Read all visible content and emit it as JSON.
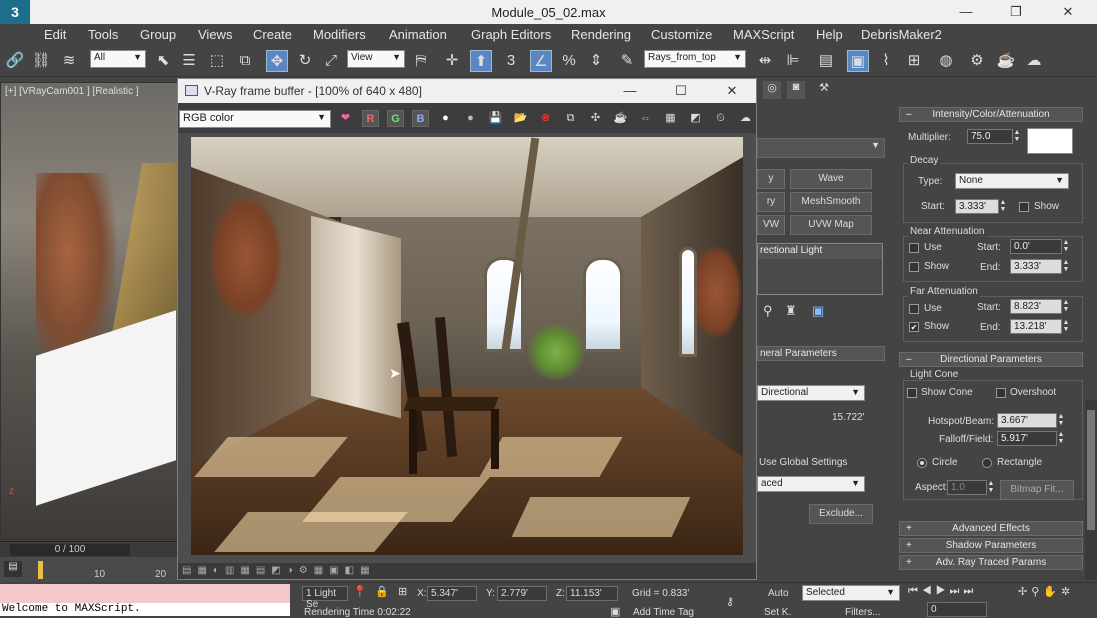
{
  "window": {
    "title": "Module_05_02.max",
    "logo": "3",
    "minimize": "—",
    "restore": "❐",
    "close": "✕"
  },
  "menu": [
    "Edit",
    "Tools",
    "Group",
    "Views",
    "Create",
    "Modifiers",
    "Animation",
    "Graph Editors",
    "Rendering",
    "Customize",
    "MAXScript",
    "Help",
    "DebrisMaker2"
  ],
  "toolbar": {
    "selection_filter": "All",
    "ref_coord": "View",
    "named_selection": "Rays_from_top",
    "snap_3": "3",
    "snap_percent": "%",
    "snap_n": "n"
  },
  "viewport": {
    "label": "[+] [VRayCam001 ] [Realistic ]",
    "axis": "z"
  },
  "timeline": {
    "position": "0 / 100",
    "ticks": [
      "10",
      "20"
    ]
  },
  "listener": {
    "text": "Welcome to MAXScript."
  },
  "vfb": {
    "title": "V-Ray frame buffer - [100% of 640 x 480]",
    "channel": "RGB color",
    "btn_r": "R",
    "btn_g": "G",
    "btn_b": "B",
    "minimize": "—",
    "maximize": "☐",
    "close": "✕"
  },
  "command_panel": {
    "modifier_buttons": {
      "wave": "Wave",
      "meshsmooth": "MeshSmooth",
      "uvwmap": "UVW Map",
      "left_partial_1": "y",
      "left_partial_2": "ry",
      "left_partial_3": "VW"
    },
    "modifier_stack_item": "rectional Light",
    "general_parameters_header": "neral Parameters",
    "light_type": "Directional",
    "targ_dist": "15.722'",
    "use_global_settings": "Use Global Settings",
    "shadow_type": "aced",
    "exclude_btn": "Exclude...",
    "intensity_header": "Intensity/Color/Attenuation",
    "multiplier_label": "Multiplier:",
    "multiplier_value": "75.0",
    "decay": {
      "title": "Decay",
      "type_label": "Type:",
      "type_value": "None",
      "start_label": "Start:",
      "start_value": "3.333'",
      "show_label": "Show"
    },
    "near_atten": {
      "title": "Near Attenuation",
      "use_label": "Use",
      "show_label": "Show",
      "start_label": "Start:",
      "start_value": "0.0'",
      "end_label": "End:",
      "end_value": "3.333'"
    },
    "far_atten": {
      "title": "Far Attenuation",
      "use_label": "Use",
      "show_label": "Show",
      "show_checked": "✔",
      "start_label": "Start:",
      "start_value": "8.823'",
      "end_label": "End:",
      "end_value": "13.218'"
    },
    "directional_header": "Directional Parameters",
    "light_cone": {
      "title": "Light Cone",
      "show_cone": "Show Cone",
      "overshoot": "Overshoot",
      "hotspot_label": "Hotspot/Beam:",
      "hotspot_value": "3.667'",
      "falloff_label": "Falloff/Field:",
      "falloff_value": "5.917'",
      "circle": "Circle",
      "rectangle": "Rectangle",
      "aspect_label": "Aspect:",
      "aspect_value": "1.0",
      "bitmap_fit": "Bitmap Fit..."
    },
    "adv_effects": "Advanced Effects",
    "shadow_params": "Shadow Parameters",
    "adv_ray": "Adv. Ray Traced Params",
    "plus": "+",
    "minus": "–"
  },
  "status": {
    "selection": "1 Light Se",
    "x_label": "X:",
    "x_value": "5.347'",
    "y_label": "Y:",
    "y_value": "2.779'",
    "z_label": "Z:",
    "z_value": "11.153'",
    "grid": "Grid = 0.833'",
    "render_time": "Rendering Time  0:02:22",
    "add_time_tag": "Add Time Tag",
    "auto": "Auto",
    "setk": "Set K.",
    "selected": "Selected",
    "filters": "Filters...",
    "frame": "0"
  },
  "colors": {
    "accent": "#5b86c4",
    "light_color_swatch": "#f5d90a"
  }
}
